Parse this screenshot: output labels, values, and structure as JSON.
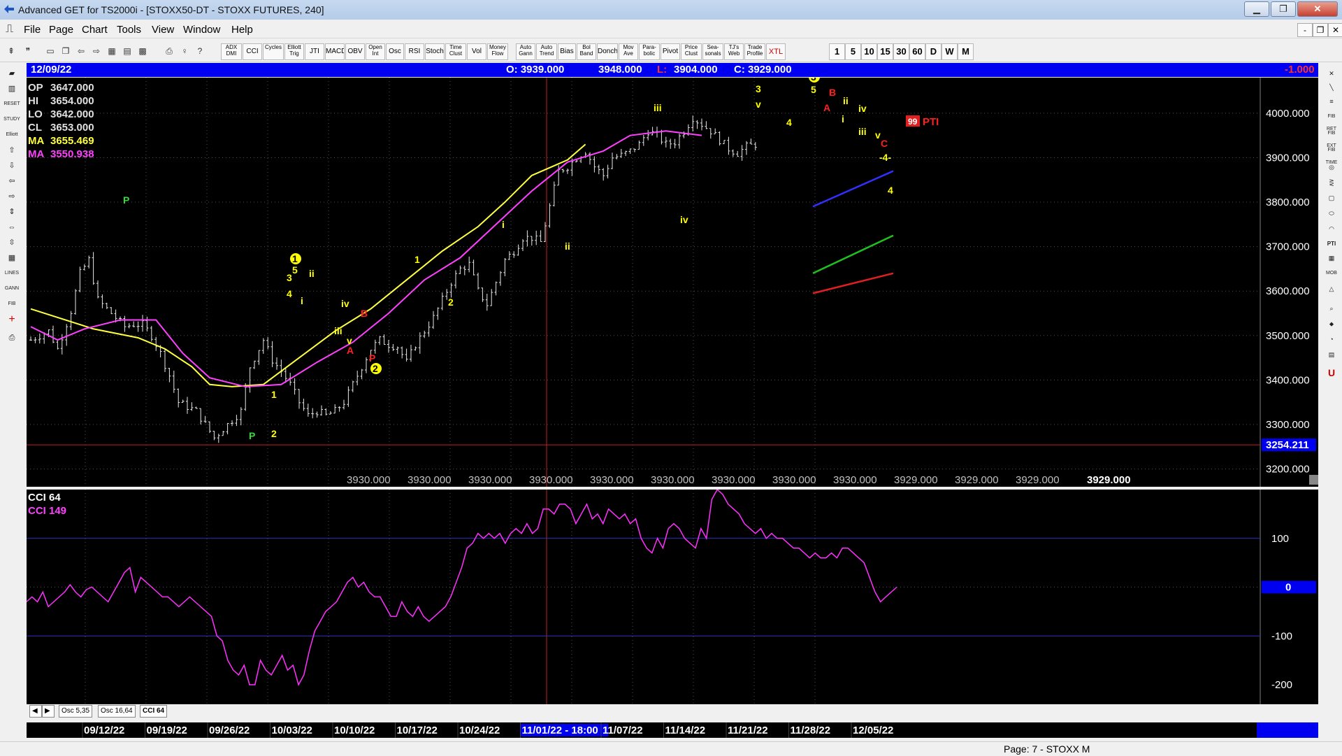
{
  "window": {
    "title": "Advanced GET for TS2000i - [STOXX50-DT - STOXX FUTURES, 240]",
    "minimize": "▁",
    "maximize": "❐",
    "close": "✕",
    "mdi_minimize": "-",
    "mdi_restore": "❐",
    "mdi_close": "✕"
  },
  "menu": [
    "File",
    "Page",
    "Chart",
    "Tools",
    "View",
    "Window",
    "Help"
  ],
  "toolbar": {
    "study_buttons": [
      "ADX DMI",
      "CCI",
      "Cycles",
      "Elliott Trig",
      "JTI",
      "MACD",
      "OBV",
      "Open Int",
      "Osc",
      "RSI",
      "Stoch",
      "Time Clust",
      "Vol",
      "Money Flow",
      "Auto Gann",
      "Auto Trend",
      "Bias",
      "Bol Band",
      "Donch",
      "Mov Ave",
      "Para- bolic",
      "Pivot",
      "Price Clust",
      "Sea- sonals",
      "TJ's Web",
      "Trade Profile",
      "XTL"
    ],
    "interval_buttons": [
      "1",
      "5",
      "10",
      "15",
      "30",
      "60",
      "D",
      "W",
      "M"
    ]
  },
  "infobar": {
    "date": "12/09/22",
    "open": "O: 3939.000",
    "high": "3948.000",
    "low_label": "L:",
    "low_value": "3904.000",
    "close": "C: 3929.000",
    "change": "-1.000"
  },
  "price_panel": {
    "values": [
      {
        "label": "OP",
        "value": "3647.000",
        "color": "#e0e0e0"
      },
      {
        "label": "HI",
        "value": "3654.000",
        "color": "#e0e0e0"
      },
      {
        "label": "LO",
        "value": "3642.000",
        "color": "#e0e0e0"
      },
      {
        "label": "CL",
        "value": "3653.000",
        "color": "#e0e0e0"
      },
      {
        "label": "MA",
        "value": "3655.469",
        "color": "#ffff40"
      },
      {
        "label": "MA",
        "value": "3550.938",
        "color": "#ff40ff"
      }
    ],
    "y_axis_labels": [
      "4000.000",
      "3900.000",
      "3800.000",
      "3700.000",
      "3600.000",
      "3500.000",
      "3400.000",
      "3300.000",
      "3200.000"
    ],
    "y_axis_values": [
      4000,
      3900,
      3800,
      3700,
      3600,
      3500,
      3400,
      3300,
      3200
    ],
    "current_price_marker": "3254.211",
    "pti_value": "99",
    "pti_label": "PTI",
    "bottom_values": [
      "3930.000",
      "3930.000",
      "3930.000",
      "3930.000",
      "3930.000",
      "3930.000",
      "3930.000",
      "3930.000",
      "3930.000",
      "3929.000",
      "3929.000",
      "3929.000",
      "3929.000"
    ],
    "last_bottom_value": "3929.000",
    "wave_labels": [
      {
        "t": "P",
        "c": "#33dd33"
      },
      {
        "t": "P",
        "c": "#33dd33"
      },
      {
        "t": "2",
        "c": "#ffff00"
      },
      {
        "t": "1",
        "c": "#ffff00"
      },
      {
        "t": "1",
        "c": "#ffff00"
      },
      {
        "t": "5",
        "c": "#ffff00"
      },
      {
        "t": "3",
        "c": "#ffff00"
      },
      {
        "t": "ii",
        "c": "#ffff00"
      },
      {
        "t": "4",
        "c": "#ffff00"
      },
      {
        "t": "i",
        "c": "#ffff00"
      },
      {
        "t": "iv",
        "c": "#ffff00"
      },
      {
        "t": "iii",
        "c": "#ffff00"
      },
      {
        "t": "v",
        "c": "#ffff00"
      },
      {
        "t": "A",
        "c": "#ff2020"
      },
      {
        "t": "B",
        "c": "#ff2020"
      },
      {
        "t": "P",
        "c": "#ff2020"
      },
      {
        "t": "2",
        "c": "#ffff00"
      },
      {
        "t": "1",
        "c": "#ffff00"
      },
      {
        "t": "2",
        "c": "#ffff00"
      },
      {
        "t": "i",
        "c": "#ffff00"
      },
      {
        "t": "ii",
        "c": "#ffff00"
      },
      {
        "t": "iii",
        "c": "#ffff00"
      },
      {
        "t": "iv",
        "c": "#ffff00"
      },
      {
        "t": "3",
        "c": "#ffff00"
      },
      {
        "t": "v",
        "c": "#ffff00"
      },
      {
        "t": "4",
        "c": "#ffff00"
      },
      {
        "t": "3",
        "c": "#ffff00"
      },
      {
        "t": "5",
        "c": "#ffff00"
      },
      {
        "t": "B",
        "c": "#ff2020"
      },
      {
        "t": "A",
        "c": "#ff2020"
      },
      {
        "t": "ii",
        "c": "#ffff00"
      },
      {
        "t": "i",
        "c": "#ffff00"
      },
      {
        "t": "iv",
        "c": "#ffff00"
      },
      {
        "t": "iii",
        "c": "#ffff00"
      },
      {
        "t": "v",
        "c": "#ffff00"
      },
      {
        "t": "C",
        "c": "#ff2020"
      },
      {
        "t": "-4-",
        "c": "#ffff00"
      },
      {
        "t": "4",
        "c": "#ffff00"
      }
    ]
  },
  "cci_panel": {
    "label": "CCI 64",
    "value_label": "CCI  149",
    "y_axis_labels": [
      "100",
      "0",
      "-100",
      "-200"
    ],
    "y_axis_values": [
      100,
      0,
      -100,
      -200
    ],
    "zero_marker": "0"
  },
  "tabs": [
    "Osc 5,35",
    "Osc 16,64",
    "CCI 64"
  ],
  "dates": [
    "09/12/22",
    "09/19/22",
    "09/26/22",
    "10/03/22",
    "10/10/22",
    "10/17/22",
    "10/24/22",
    "11/01/22 - 18:00",
    "11/07/22",
    "11/14/22",
    "11/21/22",
    "11/28/22",
    "12/05/22"
  ],
  "statusbar": {
    "page": "Page: 7 - STOXX M"
  },
  "chart_data": [
    {
      "type": "candlestick",
      "title": "",
      "ylabel": "",
      "ylim": [
        3160,
        4080
      ],
      "series": [
        {
          "name": "MA 3655.469",
          "color": "#ffff40",
          "anchors": [
            [
              0,
              3560
            ],
            [
              14,
              3515
            ],
            [
              24,
              3495
            ],
            [
              30,
              3470
            ],
            [
              36,
              3430
            ],
            [
              40,
              3390
            ],
            [
              45,
              3385
            ],
            [
              52,
              3390
            ],
            [
              60,
              3450
            ],
            [
              68,
              3510
            ],
            [
              76,
              3560
            ],
            [
              84,
              3625
            ],
            [
              92,
              3690
            ],
            [
              100,
              3745
            ],
            [
              106,
              3800
            ],
            [
              112,
              3860
            ],
            [
              120,
              3895
            ],
            [
              124,
              3930
            ]
          ]
        },
        {
          "name": "MA 3550.938",
          "color": "#ff40ff",
          "anchors": [
            [
              0,
              3520
            ],
            [
              6,
              3490
            ],
            [
              12,
              3515
            ],
            [
              20,
              3535
            ],
            [
              28,
              3535
            ],
            [
              34,
              3460
            ],
            [
              40,
              3405
            ],
            [
              48,
              3385
            ],
            [
              56,
              3390
            ],
            [
              64,
              3440
            ],
            [
              72,
              3485
            ],
            [
              80,
              3550
            ],
            [
              88,
              3625
            ],
            [
              96,
              3675
            ],
            [
              104,
              3750
            ],
            [
              112,
              3825
            ],
            [
              120,
              3890
            ],
            [
              128,
              3915
            ],
            [
              134,
              3950
            ],
            [
              142,
              3960
            ],
            [
              150,
              3950
            ]
          ]
        }
      ],
      "price_path": [
        [
          0,
          3490
        ],
        [
          4,
          3510
        ],
        [
          6,
          3470
        ],
        [
          9,
          3555
        ],
        [
          11,
          3640
        ],
        [
          13,
          3670
        ],
        [
          15,
          3580
        ],
        [
          18,
          3550
        ],
        [
          21,
          3520
        ],
        [
          23,
          3525
        ],
        [
          25,
          3525
        ],
        [
          27,
          3500
        ],
        [
          29,
          3460
        ],
        [
          31,
          3410
        ],
        [
          33,
          3350
        ],
        [
          35,
          3340
        ],
        [
          37,
          3330
        ],
        [
          39,
          3300
        ],
        [
          41,
          3270
        ],
        [
          43,
          3290
        ],
        [
          45,
          3310
        ],
        [
          47,
          3330
        ],
        [
          49,
          3430
        ],
        [
          51,
          3470
        ],
        [
          52,
          3490
        ],
        [
          54,
          3445
        ],
        [
          56,
          3420
        ],
        [
          58,
          3390
        ],
        [
          60,
          3350
        ],
        [
          62,
          3320
        ],
        [
          64,
          3330
        ],
        [
          66,
          3320
        ],
        [
          68,
          3330
        ],
        [
          70,
          3350
        ],
        [
          72,
          3390
        ],
        [
          74,
          3430
        ],
        [
          76,
          3470
        ],
        [
          78,
          3490
        ],
        [
          80,
          3480
        ],
        [
          82,
          3475
        ],
        [
          84,
          3440
        ],
        [
          86,
          3480
        ],
        [
          88,
          3510
        ],
        [
          90,
          3540
        ],
        [
          92,
          3580
        ],
        [
          94,
          3620
        ],
        [
          96,
          3650
        ],
        [
          98,
          3660
        ],
        [
          100,
          3600
        ],
        [
          102,
          3570
        ],
        [
          104,
          3620
        ],
        [
          106,
          3670
        ],
        [
          108,
          3690
        ],
        [
          110,
          3720
        ],
        [
          112,
          3720
        ],
        [
          114,
          3710
        ],
        [
          116,
          3790
        ],
        [
          118,
          3870
        ],
        [
          120,
          3880
        ],
        [
          122,
          3900
        ],
        [
          124,
          3915
        ],
        [
          126,
          3880
        ],
        [
          128,
          3860
        ],
        [
          130,
          3900
        ],
        [
          132,
          3905
        ],
        [
          134,
          3915
        ],
        [
          136,
          3930
        ],
        [
          138,
          3960
        ],
        [
          140,
          3950
        ],
        [
          142,
          3930
        ],
        [
          144,
          3935
        ],
        [
          146,
          3960
        ],
        [
          148,
          3990
        ],
        [
          150,
          3975
        ],
        [
          152,
          3960
        ],
        [
          154,
          3940
        ],
        [
          156,
          3920
        ],
        [
          158,
          3910
        ],
        [
          160,
          3925
        ],
        [
          162,
          3930
        ]
      ],
      "trend_lines": [
        {
          "color": "#3030ff",
          "from": [
            3790
          ],
          "to": [
            3870
          ]
        },
        {
          "color": "#20c020",
          "from": [
            3640
          ],
          "to": [
            3725
          ]
        },
        {
          "color": "#e02020",
          "from": [
            3595
          ],
          "to": [
            3640
          ]
        }
      ]
    },
    {
      "type": "line",
      "title": "",
      "ylabel": "",
      "ylim": [
        -240,
        200
      ],
      "series": [
        {
          "name": "CCI 64",
          "color": "#ff30ff",
          "values": [
            -30,
            -20,
            -30,
            -10,
            -40,
            -30,
            -20,
            -10,
            5,
            -10,
            -20,
            -5,
            0,
            -10,
            -20,
            -30,
            -10,
            10,
            30,
            40,
            -10,
            20,
            10,
            0,
            -10,
            -20,
            -20,
            -30,
            -40,
            -30,
            -20,
            -30,
            -40,
            -50,
            -60,
            -100,
            -110,
            -150,
            -170,
            -180,
            -160,
            -200,
            -200,
            -150,
            -170,
            -180,
            -160,
            -140,
            -170,
            -160,
            -200,
            -180,
            -130,
            -90,
            -70,
            -50,
            -40,
            -30,
            -10,
            10,
            20,
            0,
            10,
            -10,
            -20,
            -20,
            -40,
            -60,
            -60,
            -30,
            -50,
            -60,
            -40,
            -60,
            -70,
            -60,
            -50,
            -40,
            -20,
            10,
            40,
            80,
            90,
            110,
            100,
            110,
            100,
            110,
            90,
            110,
            120,
            110,
            130,
            110,
            120,
            160,
            160,
            150,
            170,
            170,
            160,
            130,
            150,
            170,
            140,
            150,
            130,
            160,
            150,
            140,
            150,
            130,
            140,
            100,
            80,
            70,
            100,
            80,
            120,
            130,
            120,
            100,
            90,
            80,
            120,
            100,
            180,
            200,
            190,
            170,
            160,
            150,
            130,
            120,
            110,
            120,
            100,
            110,
            100,
            100,
            90,
            80,
            80,
            70,
            60,
            70,
            60,
            60,
            70,
            60,
            80,
            80,
            70,
            60,
            50,
            20,
            -10,
            -30,
            -20,
            -10,
            0
          ]
        }
      ],
      "reference_lines": [
        100,
        0,
        -100
      ]
    }
  ]
}
